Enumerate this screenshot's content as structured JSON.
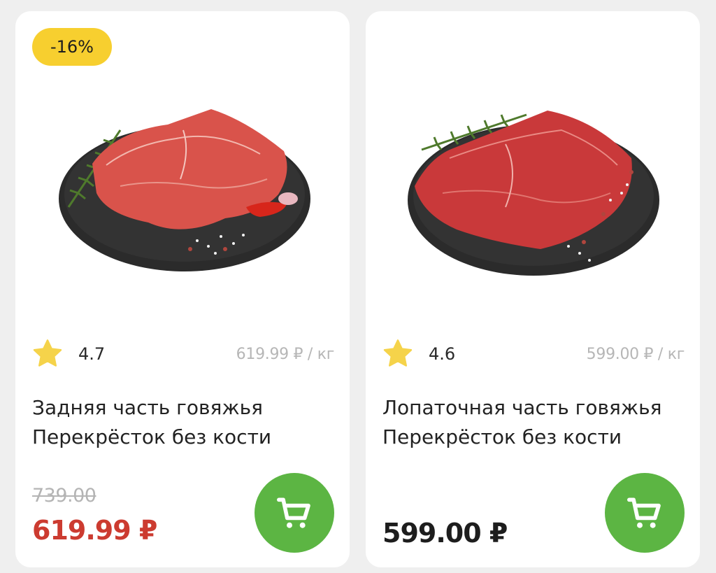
{
  "currency_sign": "₽",
  "colors": {
    "accent_green": "#5cb543",
    "badge_yellow": "#f7cf2f",
    "sale_red": "#cc3b30",
    "star_yellow": "#f5d34a"
  },
  "products": [
    {
      "badge": "-16%",
      "image_icon": "beef-steak-on-slate",
      "rating": "4.7",
      "unit_price": "619.99 ₽ / кг",
      "name_line1": "Задняя часть говяжья",
      "name_line2": "Перекрёсток без кости",
      "old_price": "739.00",
      "price": "619.99 ₽",
      "cart_icon": "cart-icon"
    },
    {
      "badge": null,
      "image_icon": "beef-steak-on-slate",
      "rating": "4.6",
      "unit_price": "599.00 ₽ / кг",
      "name_line1": "Лопаточная часть говяжья",
      "name_line2": "Перекрёсток без кости",
      "old_price": null,
      "price": "599.00 ₽",
      "cart_icon": "cart-icon"
    }
  ]
}
